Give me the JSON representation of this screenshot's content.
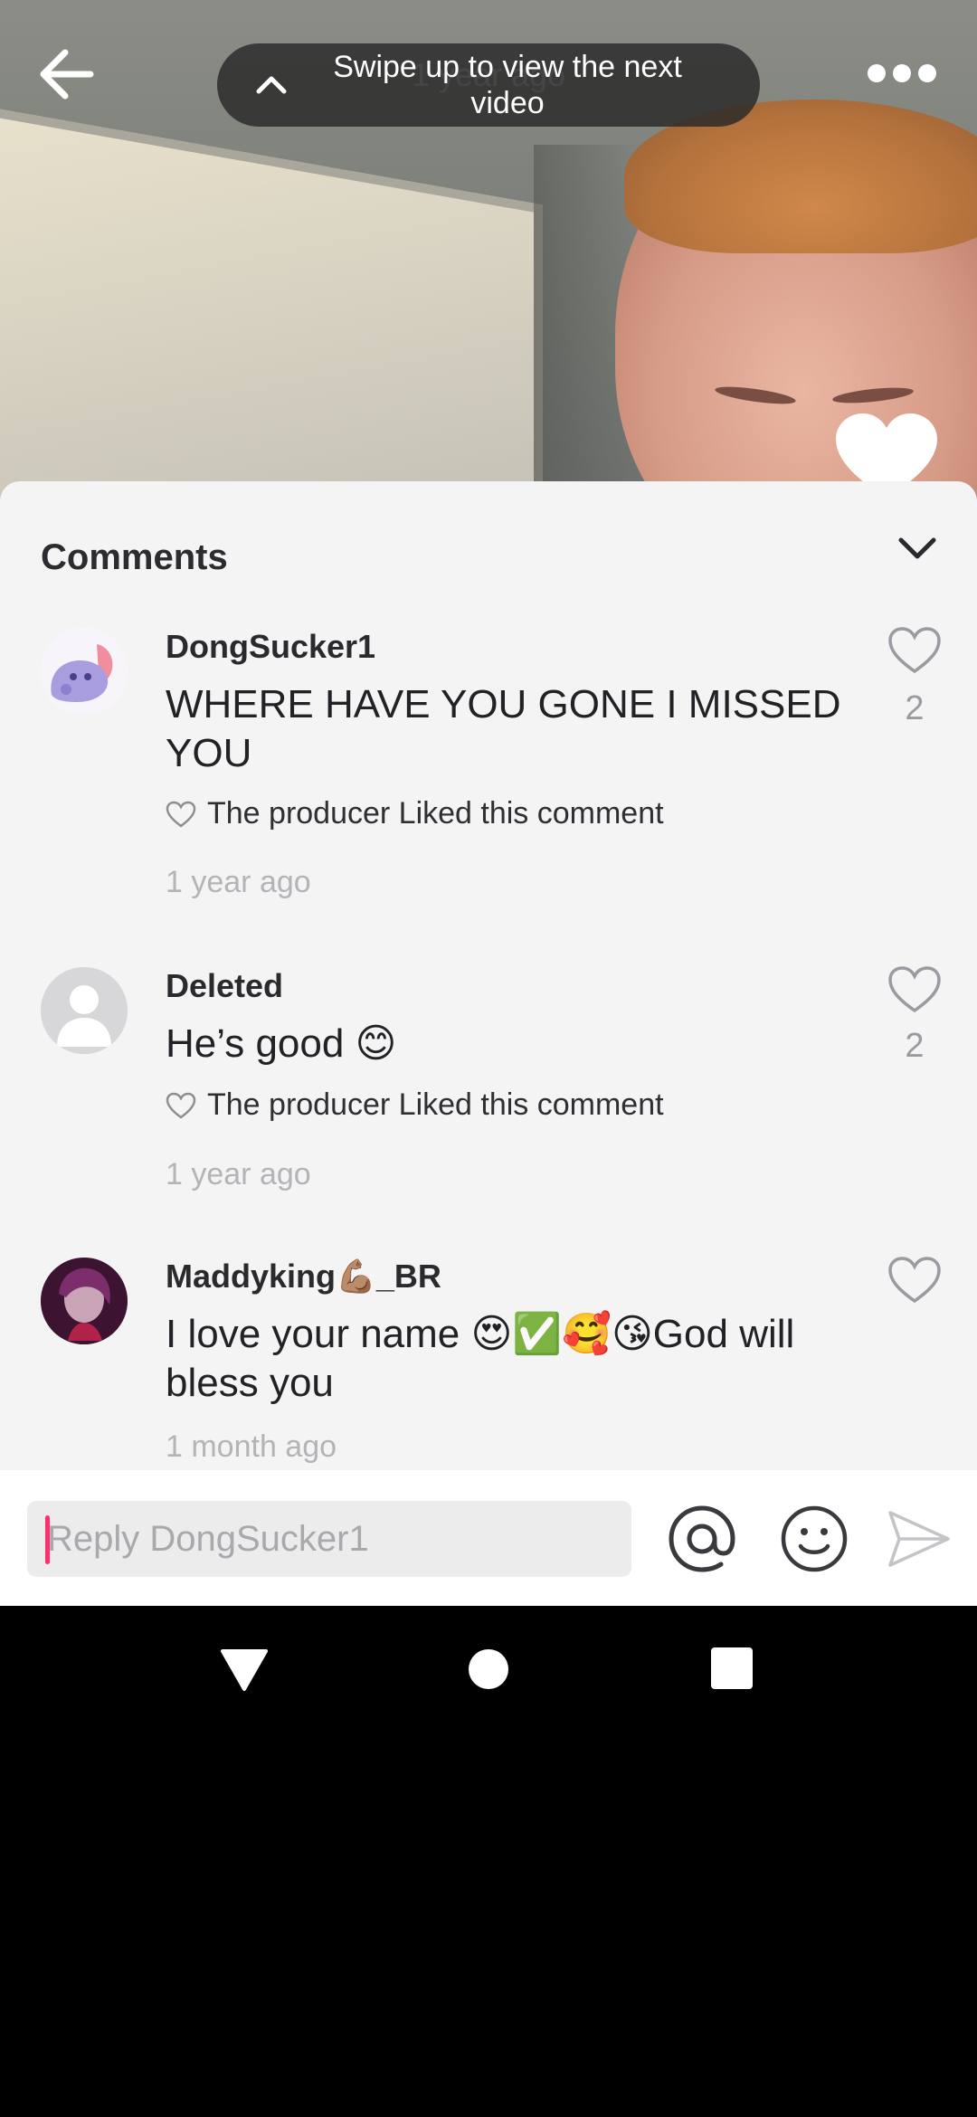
{
  "video": {
    "timestamp": "1 year ago",
    "swipe_hint": "Swipe up to view the next video"
  },
  "comments_sheet": {
    "title": "Comments",
    "comments": [
      {
        "username": "DongSucker1",
        "text": "WHERE HAVE YOU GONE I MISSED YOU",
        "producer_like_note": "The producer Liked this comment",
        "time": "1 year ago",
        "like_count": "2"
      },
      {
        "username": "Deleted",
        "text": "He’s good 😊",
        "producer_like_note": "The producer Liked this comment",
        "time": "1 year ago",
        "like_count": "2"
      },
      {
        "username": "Maddyking💪🏽_BR",
        "text": "I love your name 😍✅🥰😘God will bless you",
        "time": "1 month ago"
      }
    ]
  },
  "reply_bar": {
    "placeholder": "Reply DongSucker1",
    "value": ""
  },
  "icons": {
    "back": "back-arrow-icon",
    "more": "more-horizontal-icon",
    "collapse": "chevron-down-icon",
    "like": "heart-outline-icon",
    "mention": "at-sign-icon",
    "emoji": "smiley-icon",
    "send": "send-icon"
  },
  "colors": {
    "accent_caret": "#ff2f6d",
    "sheet_background": "#f4f4f5",
    "muted_text": "#b4b4b8"
  }
}
